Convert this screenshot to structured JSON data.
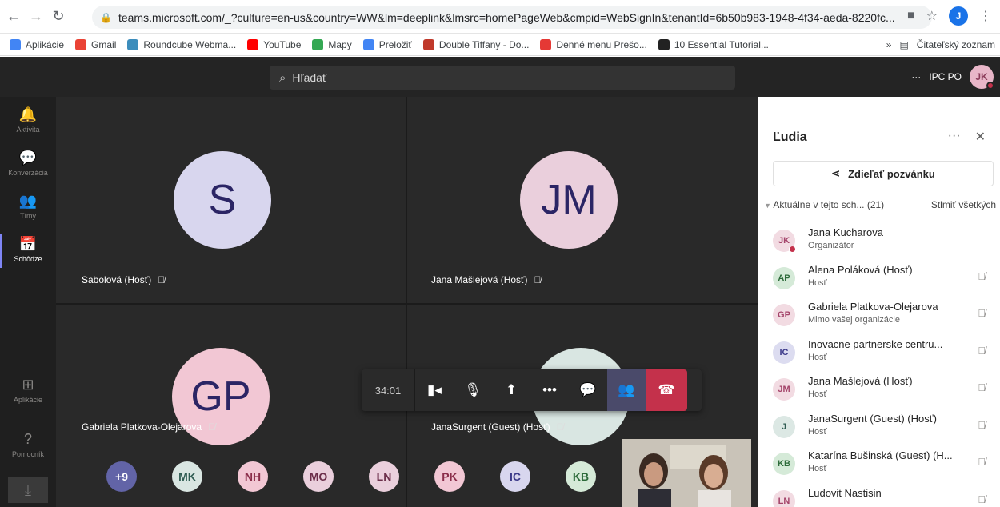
{
  "browser": {
    "url": "teams.microsoft.com/_?culture=en-us&country=WW&lm=deeplink&lmsrc=homePageWeb&cmpid=WebSignIn&tenantId=6b50b983-1948-4f34-aeda-8220fc...",
    "profile_initial": "J"
  },
  "bookmarks": {
    "items": [
      {
        "label": "Aplikácie",
        "color": "#4285f4"
      },
      {
        "label": "Gmail",
        "color": "#ea4335"
      },
      {
        "label": "Roundcube Webma...",
        "color": "#3c8dbc"
      },
      {
        "label": "YouTube",
        "color": "#ff0000"
      },
      {
        "label": "Mapy",
        "color": "#34a853"
      },
      {
        "label": "Preložiť",
        "color": "#4285f4"
      },
      {
        "label": "Double Tiffany - Do...",
        "color": "#c0392b"
      },
      {
        "label": "Denné menu Prešo...",
        "color": "#e53935"
      },
      {
        "label": "10 Essential Tutorial...",
        "color": "#222222"
      }
    ],
    "more": "»",
    "reading_list": "Čitateľský zoznam"
  },
  "teams": {
    "search_placeholder": "Hľadať",
    "org_name": "IPC PO",
    "my_initials": "JK",
    "more": "···"
  },
  "rail": [
    {
      "label": "Aktivita",
      "icon": "bell-icon",
      "glyph": "🔔"
    },
    {
      "label": "Konverzácia",
      "icon": "chat-icon",
      "glyph": "💬"
    },
    {
      "label": "Tímy",
      "icon": "teams-icon",
      "glyph": "👥"
    },
    {
      "label": "Schôdze",
      "icon": "calendar-icon",
      "glyph": "📅"
    },
    {
      "label": "···",
      "icon": "more-icon",
      "glyph": ""
    },
    {
      "label": "Aplikácie",
      "icon": "apps-icon",
      "glyph": "⊞"
    },
    {
      "label": "Pomocník",
      "icon": "help-icon",
      "glyph": "?"
    }
  ],
  "stage": {
    "tiles": [
      {
        "initials": "S",
        "name": "Sabolová (Hosť)",
        "color": "#d8d6ee"
      },
      {
        "initials": "JM",
        "name": "Jana Mašlejová (Hosť)",
        "color": "#eacfdc"
      },
      {
        "initials": "GP",
        "name": "Gabriela Platkova-Olejarova",
        "color": "#f2c7d4"
      },
      {
        "initials": "J",
        "name": "JanaSurgent (Guest) (Hosť)",
        "color": "#d9e6e2"
      }
    ],
    "small_avatars": [
      {
        "initials": "+9",
        "bg": "#6264a7",
        "fg": "#ffffff"
      },
      {
        "initials": "MK",
        "bg": "#d9e6e2",
        "fg": "#2f5c52"
      },
      {
        "initials": "NH",
        "bg": "#f2c7d4",
        "fg": "#8b2d4a"
      },
      {
        "initials": "MO",
        "bg": "#eacfdc",
        "fg": "#6b2e4a"
      },
      {
        "initials": "LN",
        "bg": "#eacfdc",
        "fg": "#6b2e4a"
      },
      {
        "initials": "PK",
        "bg": "#f2c7d4",
        "fg": "#8b2d4a"
      },
      {
        "initials": "IC",
        "bg": "#d8d6ee",
        "fg": "#3c3a8a"
      },
      {
        "initials": "KB",
        "bg": "#d5ead8",
        "fg": "#2d6b3a"
      }
    ],
    "timer": "34:01"
  },
  "panel": {
    "title": "Ľudia",
    "share_label": "Zdieľať pozvánku",
    "section_label": "Aktuálne v tejto sch...",
    "section_count": "(21)",
    "mute_all": "Stlmiť všetkých",
    "people": [
      {
        "initials": "JK",
        "name": "Jana Kucharova",
        "role": "Organizátor",
        "bg": "#f2dbe2",
        "fg": "#a4446a",
        "muted": false,
        "status": true
      },
      {
        "initials": "AP",
        "name": "Alena Poláková (Hosť)",
        "role": "Hosť",
        "bg": "#d5ead8",
        "fg": "#2d6b3a",
        "muted": true
      },
      {
        "initials": "GP",
        "name": "Gabriela Platkova-Olejarova",
        "role": "Mimo vašej organizácie",
        "bg": "#f2dbe2",
        "fg": "#a4446a",
        "muted": true
      },
      {
        "initials": "IC",
        "name": "Inovacne partnerske centru...",
        "role": "Hosť",
        "bg": "#dcdcf0",
        "fg": "#3c3a8a",
        "muted": true
      },
      {
        "initials": "JM",
        "name": "Jana Mašlejová (Hosť)",
        "role": "Hosť",
        "bg": "#f2dbe2",
        "fg": "#a4446a",
        "muted": true
      },
      {
        "initials": "J",
        "name": "JanaSurgent (Guest) (Hosť)",
        "role": "Hosť",
        "bg": "#dce8e4",
        "fg": "#2f5c52",
        "muted": true
      },
      {
        "initials": "KB",
        "name": "Katarína Bušinská (Guest) (H...",
        "role": "Hosť",
        "bg": "#d5ead8",
        "fg": "#2d6b3a",
        "muted": true
      },
      {
        "initials": "LN",
        "name": "Ludovit Nastisin",
        "role": "",
        "bg": "#f2dbe2",
        "fg": "#a4446a",
        "muted": true
      }
    ]
  }
}
